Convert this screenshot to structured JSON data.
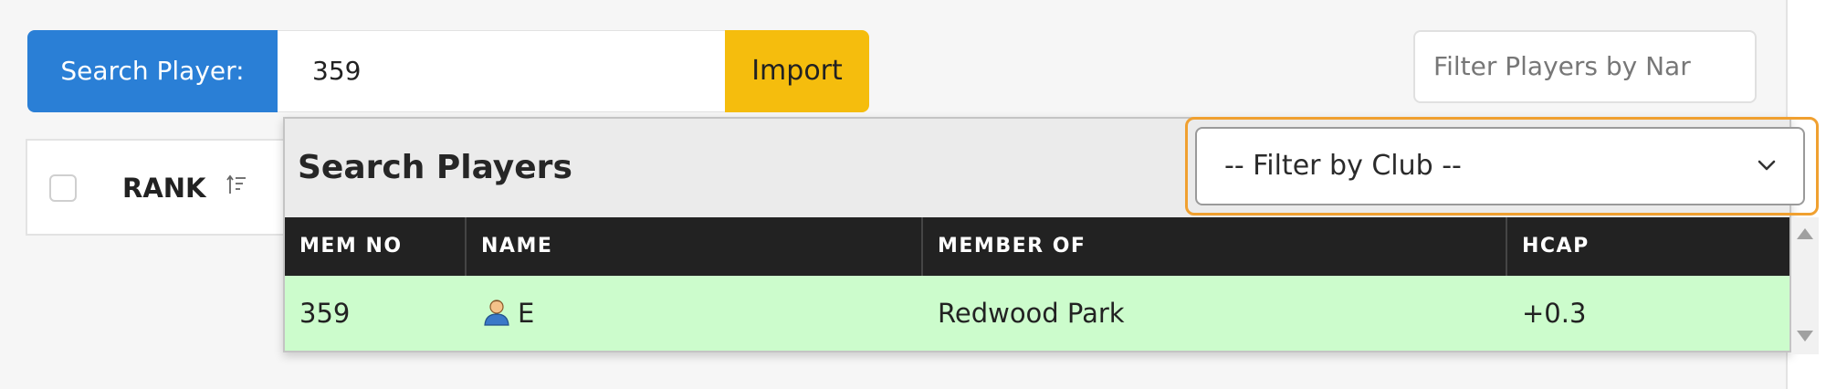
{
  "search": {
    "label": "Search Player:",
    "value": "359",
    "import_label": "Import",
    "filter_placeholder": "Filter Players by Nar"
  },
  "background_table": {
    "rank_header": "RANK",
    "sort_icon": "sort-ascending-icon"
  },
  "popup": {
    "title": "Search Players",
    "club_filter": {
      "selected": "-- Filter by Club --"
    },
    "columns": [
      "MEM NO",
      "NAME",
      "MEMBER OF",
      "HCAP"
    ],
    "rows": [
      {
        "mem_no": "359",
        "name": "E",
        "member_of": "Redwood Park",
        "hcap": "+0.3",
        "icon": "person-icon"
      }
    ]
  },
  "colors": {
    "search_label_bg": "#2a7fd6",
    "import_bg": "#f5bd0d",
    "header_bg": "#222222",
    "row_bg": "#ccfccc",
    "focus_outline": "#f0a030"
  }
}
